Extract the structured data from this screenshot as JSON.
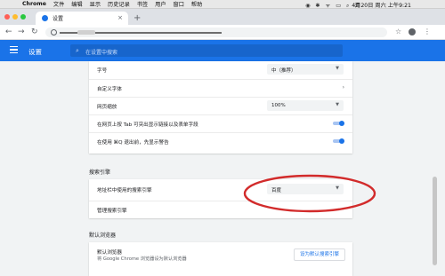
{
  "menubar": {
    "apple_glyph": "",
    "app_name": "Chrome",
    "menus": [
      "文件",
      "编辑",
      "显示",
      "历史记录",
      "书签",
      "用户",
      "窗口",
      "帮助"
    ],
    "status_icons": "◉ ✱ ᯤ ▭ ⌕ ☰",
    "datetime": "4月20日 周六 上午9:21"
  },
  "tab": {
    "title": "设置",
    "close_glyph": "×",
    "newtab_glyph": "+"
  },
  "traffic_colors": [
    "#ff5f57",
    "#febc2e",
    "#28c840"
  ],
  "toolbar": {
    "back_glyph": "←",
    "forward_glyph": "→",
    "reload_glyph": "↻",
    "star_glyph": "☆",
    "menu_glyph": "⋮"
  },
  "header": {
    "title": "设置",
    "search_icon": "⌕",
    "search_placeholder": "在设置中搜索",
    "accent_color": "#1a73e8"
  },
  "appearance": {
    "font_size_label": "字号",
    "font_size_value": "中（推荐）",
    "custom_fonts_label": "自定义字体",
    "page_zoom_label": "网页缩放",
    "page_zoom_value": "100%",
    "tab_highlight_label": "在网页上按 Tab 可突出显示链接以及表单字段",
    "tab_highlight_on": true,
    "quit_warning_label": "在使用 ⌘Q 退出前，先显示警告",
    "quit_warning_on": true
  },
  "search_engine": {
    "section_title": "搜索引擎",
    "address_bar_label": "地址栏中使用的搜索引擎",
    "address_bar_value": "百度",
    "manage_label": "管理搜索引擎"
  },
  "default_browser": {
    "section_title": "默认浏览器",
    "label": "默认浏览器",
    "sub": "将 Google Chrome 浏览器设为默认浏览器",
    "button": "设为默认搜索引擎"
  },
  "glyphs": {
    "arrow": "›",
    "caret": "▼"
  },
  "annotation_color": "#d22b2b"
}
